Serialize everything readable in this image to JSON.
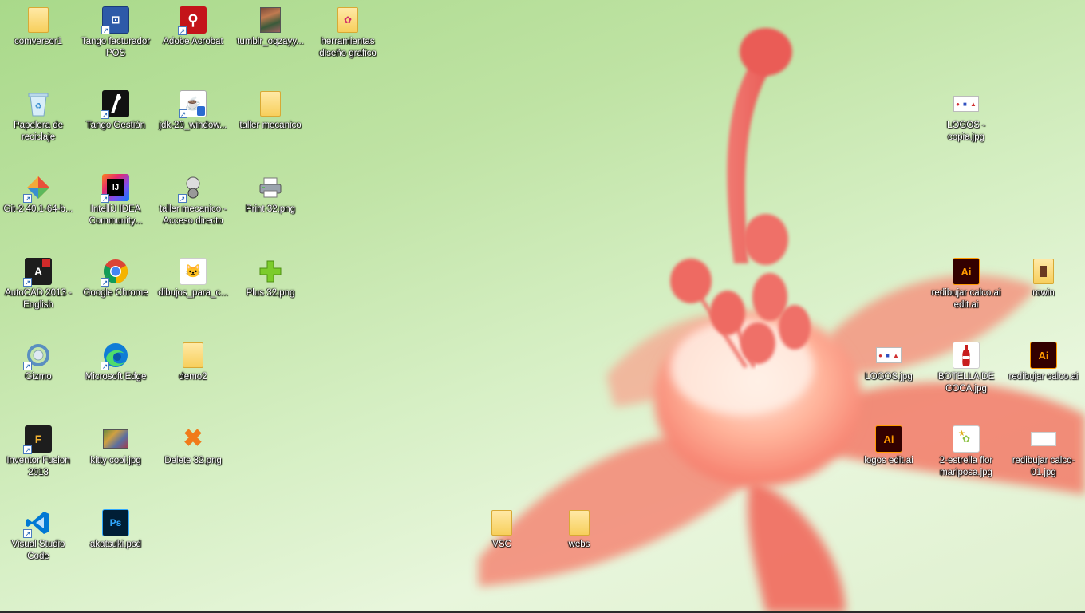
{
  "desktop": {
    "icons": [
      {
        "label": "comversor1",
        "icon": "folder-icon"
      },
      {
        "label": "Tango facturador POS",
        "icon": "tango-pos-icon"
      },
      {
        "label": "Adobe Acrobat",
        "icon": "adobe-acrobat-icon"
      },
      {
        "label": "tumblr_oqzayy...",
        "icon": "image-file-icon"
      },
      {
        "label": "herramientas diseño grafico",
        "icon": "folder-icon"
      },
      {
        "label": "Papelera de reciclaje",
        "icon": "recycle-bin-icon"
      },
      {
        "label": "Tango Gestión",
        "icon": "tango-gestion-icon"
      },
      {
        "label": "jdk-20_window...",
        "icon": "java-installer-icon"
      },
      {
        "label": "taller mecanico",
        "icon": "folder-icon"
      },
      {
        "label": "Git-2.40.1-64-b...",
        "icon": "git-installer-icon"
      },
      {
        "label": "IntelliJ IDEA Community...",
        "icon": "intellij-idea-icon"
      },
      {
        "label": "taller mecanico - Acceso directo",
        "icon": "shortcut-folder-icon"
      },
      {
        "label": "Print 32.png",
        "icon": "printer-icon"
      },
      {
        "label": "AutoCAD 2013 - English",
        "icon": "autocad-icon"
      },
      {
        "label": "Google Chrome",
        "icon": "chrome-icon"
      },
      {
        "label": "dibujos_para_c...",
        "icon": "image-file-icon"
      },
      {
        "label": "Plus 32.png",
        "icon": "plus-icon"
      },
      {
        "label": "Gizmo",
        "icon": "gizmo-icon"
      },
      {
        "label": "Microsoft Edge",
        "icon": "edge-icon"
      },
      {
        "label": "demo2",
        "icon": "folder-icon"
      },
      {
        "label": "Inventor Fusion 2013",
        "icon": "inventor-fusion-icon"
      },
      {
        "label": "kitty cool.jpg",
        "icon": "image-file-icon"
      },
      {
        "label": "Delete 32.png",
        "icon": "delete-icon"
      },
      {
        "label": "Visual Studio Code",
        "icon": "vscode-icon"
      },
      {
        "label": "akatsuki.psd",
        "icon": "photoshop-file-icon"
      },
      {
        "label": "VSC",
        "icon": "folder-icon"
      },
      {
        "label": "webs",
        "icon": "folder-icon"
      },
      {
        "label": "LOGOS - copia.jpg",
        "icon": "image-file-icon"
      },
      {
        "label": "redibujar calco.ai edit.ai",
        "icon": "illustrator-file-icon"
      },
      {
        "label": "rowin",
        "icon": "folder-icon"
      },
      {
        "label": "LOGOS.jpg",
        "icon": "image-file-icon"
      },
      {
        "label": "BOTELLA DE COCA.jpg",
        "icon": "image-file-icon"
      },
      {
        "label": "redibujar calco.ai",
        "icon": "illustrator-file-icon"
      },
      {
        "label": "logos edit.ai",
        "icon": "illustrator-file-icon"
      },
      {
        "label": "2-estrella flor mariposa.jpg",
        "icon": "image-file-icon"
      },
      {
        "label": "redibujar calco-01.jpg",
        "icon": "image-file-icon"
      }
    ]
  },
  "colors": {
    "folder": "#f7cf5c",
    "chrome_red": "#db4437",
    "edge_blue": "#0f7cd6",
    "illustrator_bg": "#330000",
    "illustrator_fg": "#ff9a00",
    "photoshop_bg": "#001e36",
    "vscode_blue": "#0078d4",
    "acrobat_red": "#c4141a"
  }
}
